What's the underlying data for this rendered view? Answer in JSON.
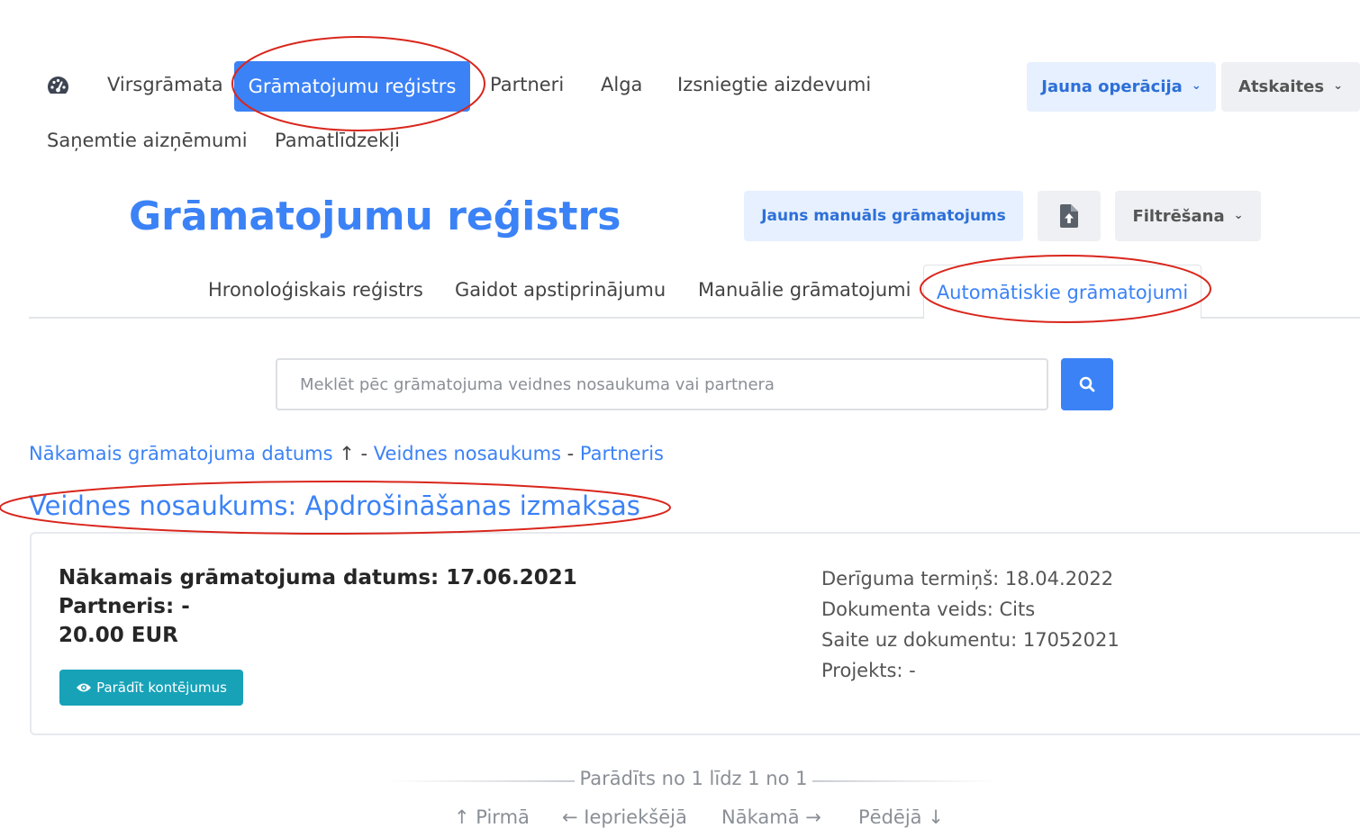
{
  "nav": {
    "dashboard_icon": "gauge-icon",
    "items": [
      {
        "label": "Virsgrāmata"
      },
      {
        "label": "Grāmatojumu reģistrs",
        "active": true
      },
      {
        "label": "Partneri"
      },
      {
        "label": "Alga"
      },
      {
        "label": "Izsniegtie aizdevumi"
      },
      {
        "label": "Saņemtie aizņēmumi"
      },
      {
        "label": "Pamatlīdzekļi"
      }
    ],
    "new_operation_label": "Jauna operācija",
    "reports_label": "Atskaites"
  },
  "page": {
    "title": "Grāmatojumu reģistrs",
    "new_manual_entry_label": "Jauns manuāls grāmatojums",
    "upload_icon": "file-upload-icon",
    "filter_label": "Filtrēšana"
  },
  "tabs": [
    {
      "label": "Hronoloģiskais reģistrs"
    },
    {
      "label": "Gaidot apstiprinājumu"
    },
    {
      "label": "Manuālie grāmatojumi"
    },
    {
      "label": "Automātiskie grāmatojumi",
      "active": true
    }
  ],
  "search": {
    "placeholder": "Meklēt pēc grāmatojuma veidnes nosaukuma vai partnera",
    "value": ""
  },
  "sort": {
    "next_date": "Nākamais grāmatojuma datums",
    "arrow": "↑",
    "sep": " - ",
    "template_name": "Veidnes nosaukums",
    "partner": "Partneris"
  },
  "group": {
    "heading": "Veidnes nosaukums: Apdrošināšanas izmaksas"
  },
  "entry": {
    "next_date_line": "Nākamais grāmatojuma datums: 17.06.2021",
    "partner_line": "Partneris: -",
    "amount": "20.00 EUR",
    "show_button": "Parādīt kontējumus",
    "validity": "Derīguma termiņš: 18.04.2022",
    "doc_type": "Dokumenta veids: Cits",
    "doc_link": "Saite uz dokumentu: 17052021",
    "project": "Projekts: -"
  },
  "pagination": {
    "info": "Parādīts no 1 līdz 1 no 1",
    "first": "↑ Pirmā",
    "prev": "← Iepriekšējā",
    "next": "Nākamā →",
    "last": "Pēdējā ↓"
  },
  "colors": {
    "accent": "#3b82f6",
    "teal_button": "#17a2b8",
    "annotation_red": "#d9261c"
  }
}
